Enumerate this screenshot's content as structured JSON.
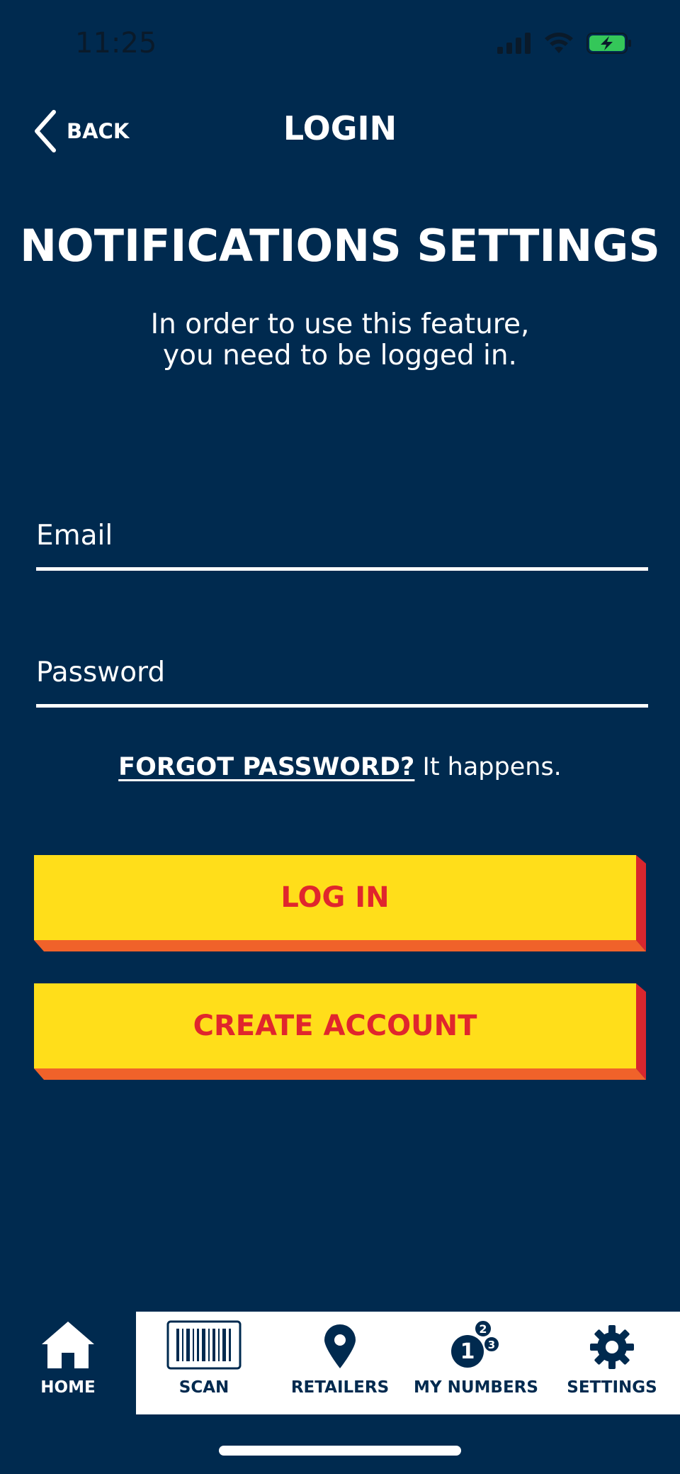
{
  "status_bar": {
    "time": "11:25"
  },
  "nav": {
    "back_label": "BACK",
    "title": "LOGIN"
  },
  "page": {
    "title": "NOTIFICATIONS SETTINGS",
    "subtitle_line1": "In order to use this feature,",
    "subtitle_line2": "you need to be logged in."
  },
  "form": {
    "email_placeholder": "Email",
    "password_placeholder": "Password",
    "forgot_link": "FORGOT PASSWORD?",
    "forgot_tail": " It happens.",
    "login_button": "LOG IN",
    "create_button": "CREATE ACCOUNT"
  },
  "tabs": [
    {
      "label": "HOME",
      "icon": "home-icon",
      "active": true
    },
    {
      "label": "SCAN",
      "icon": "barcode-icon"
    },
    {
      "label": "RETAILERS",
      "icon": "map-pin-icon"
    },
    {
      "label": "MY NUMBERS",
      "icon": "numbers-icon"
    },
    {
      "label": "SETTINGS",
      "icon": "gear-icon"
    }
  ],
  "colors": {
    "background": "#002a4f",
    "button_face": "#ffde1a",
    "button_text": "#e0262d",
    "button_side": "#d9262e",
    "button_bottom": "#f0622a",
    "battery": "#34c759"
  }
}
